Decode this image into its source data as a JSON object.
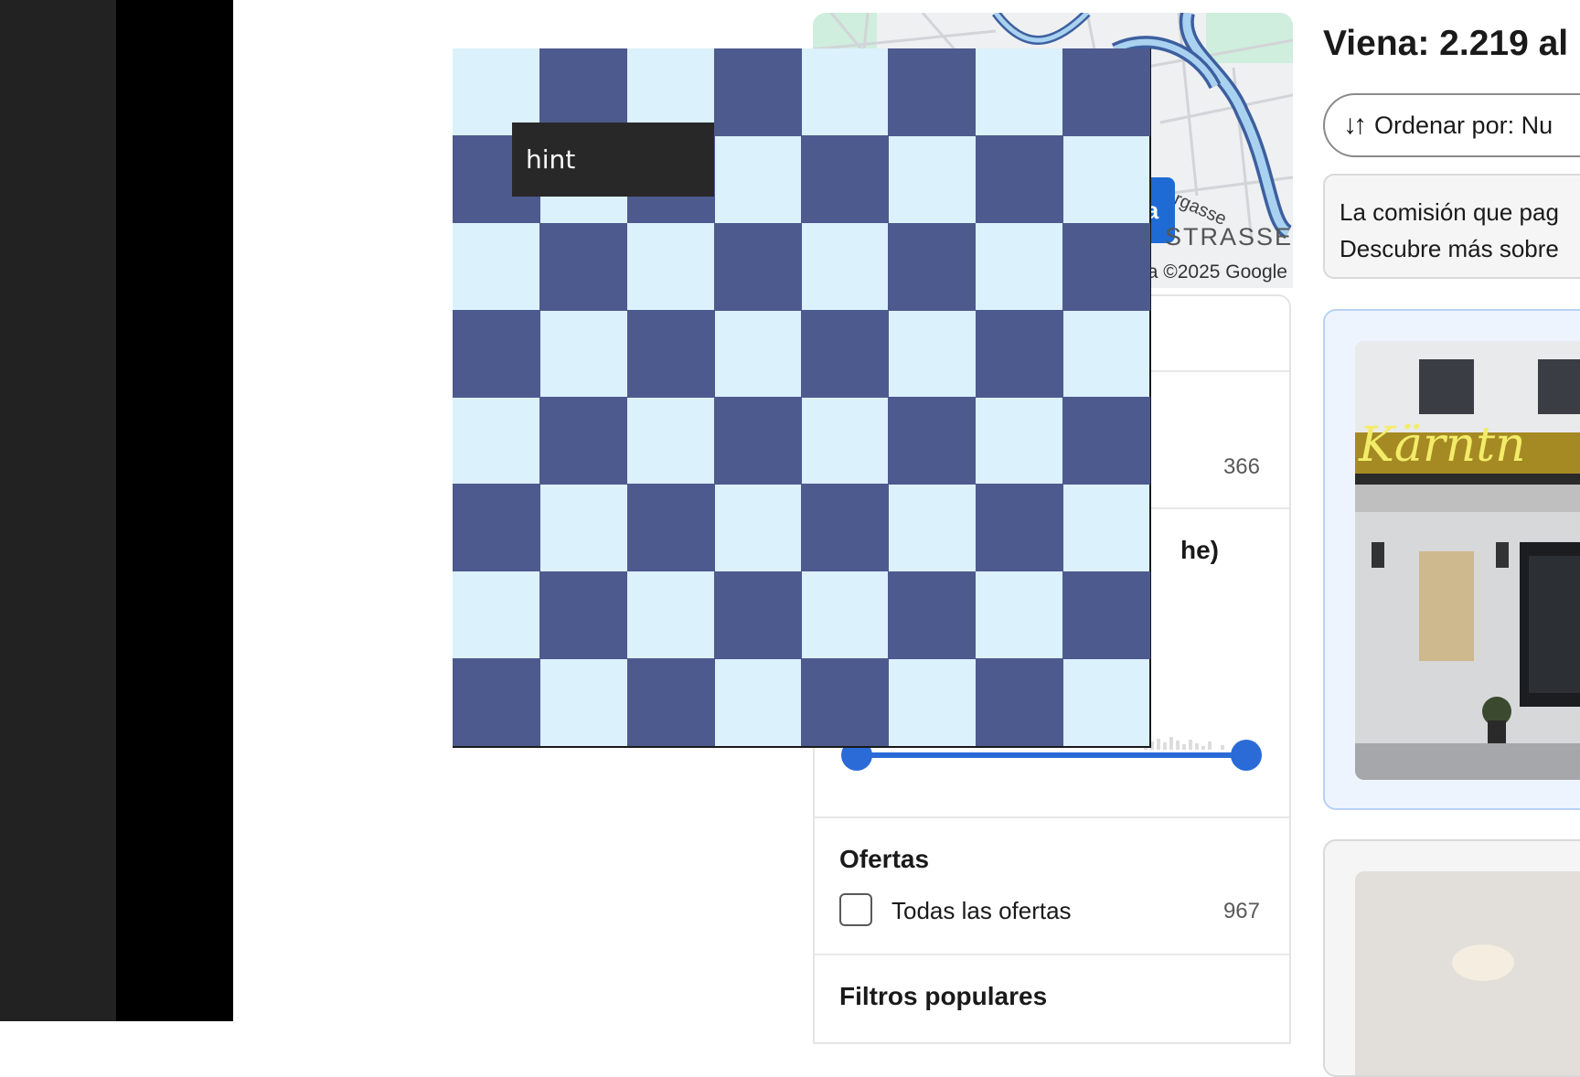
{
  "overlay": {
    "hint_label": "hint",
    "board": {
      "columns": 8,
      "rows": 8,
      "light_color": "#dbf1fb",
      "dark_color": "#4d5a8e"
    }
  },
  "map": {
    "button_label": "a",
    "road_label": "Marxergasse",
    "street_label": "STRASSE",
    "credit": "a ©2025 Google"
  },
  "filters": {
    "first_count": "366",
    "section_heading_fragment": "he)",
    "offers": {
      "heading": "Ofertas",
      "option_label": "Todas las ofertas",
      "option_count": "967"
    },
    "popular_heading": "Filtros populares"
  },
  "results": {
    "title": "Viena: 2.219 al",
    "sort_icon": "↓↑",
    "sort_label": "Ordenar por: Nu",
    "note_line1": "La comisión que pag",
    "note_line2": "Descubre más sobre",
    "hotel_sign_text": "Kärntn"
  },
  "colors": {
    "accent": "#2a6bd8",
    "sidebar_dark": "#222222",
    "sidebar_black": "#000000"
  }
}
